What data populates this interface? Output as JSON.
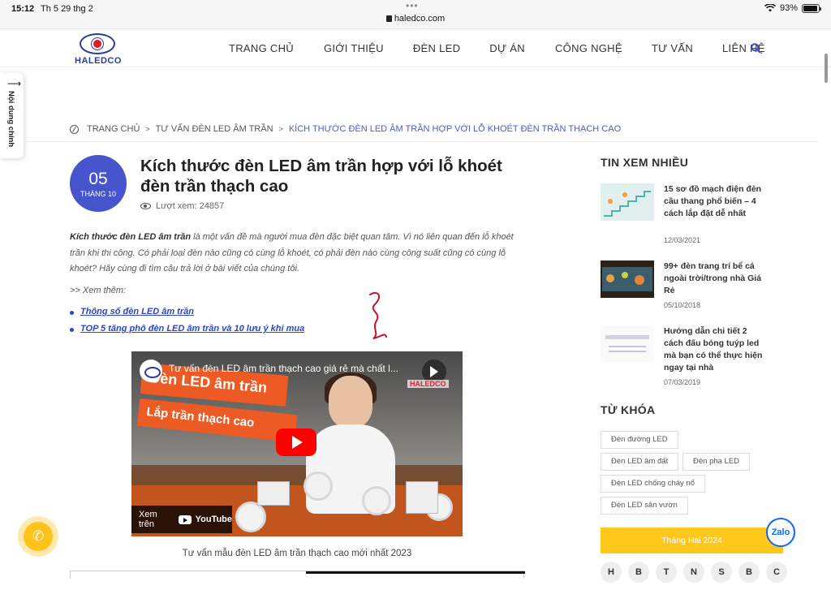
{
  "status_bar": {
    "time": "15:12",
    "date": "Th 5 29 thg 2",
    "url": "haledco.com",
    "battery": "93%",
    "dots": "•••"
  },
  "header": {
    "logo_text": "HALEDCO",
    "nav": [
      "TRANG CHỦ",
      "GIỚI THIỆU",
      "ĐÈN LED",
      "DỰ ÁN",
      "CÔNG NGHỆ",
      "TƯ VẤN",
      "LIÊN HỆ"
    ]
  },
  "side_tab": {
    "label": "Nội dung chính"
  },
  "breadcrumb": {
    "home": "TRANG CHỦ",
    "category": "TƯ VẤN ĐÈN LED ÂM TRẦN",
    "current": "KÍCH THƯỚC ĐÈN LED ÂM TRẦN HỢP VỚI LỖ KHOÉT ĐÈN TRẦN THẠCH CAO"
  },
  "article": {
    "date_day": "05",
    "date_month": "THÁNG 10",
    "title": "Kích thước đèn LED âm trần hợp với lỗ khoét đèn trần thạch cao",
    "views": "Lượt xem: 24857",
    "intro_bold": "Kích thước đèn LED âm trần",
    "intro_rest": " là một vấn đề mà người mua đèn đặc biệt quan tâm. Vì nó liên quan đến lỗ khoét trần khi thi công. Có phải loại đèn nào cũng có cùng lỗ khoét, có phải đèn nào cùng công suất cũng có cùng lỗ khoét? Hãy cùng đi tìm câu trả lời ở bài viết của chúng tôi.",
    "see_also": ">> Xem thêm:",
    "links": [
      "Thông số đèn LED âm trần",
      "TOP 5 tăng phô đèn LED âm trần và 10 lưu ý khi mua"
    ],
    "video": {
      "title": "Tư vấn đèn LED âm trần thạch cao giá rẻ mà chất l...",
      "banner1": "Đèn LED âm trần",
      "banner2": "Lắp trần thạch cao",
      "brand": "HALEDCO",
      "watch_label": "Xem trên",
      "yt_word": "YouTube"
    },
    "caption": "Tư vấn mẫu đèn LED âm trần thạch cao mới nhất 2023"
  },
  "sidebar": {
    "popular_heading": "TIN XEM NHIỀU",
    "posts": [
      {
        "title": "15 sơ đồ mạch điện đèn cầu thang phổ biến – 4 cách lắp đặt dễ nhất",
        "date": "12/03/2021"
      },
      {
        "title": "99+ đèn trang trí bể cá ngoài trời/trong nhà Giá Rẻ",
        "date": "05/10/2018"
      },
      {
        "title": "Hướng dẫn chi tiết 2 cách đấu bóng tuýp led mà bạn có thể thực hiện ngay tại nhà",
        "date": "07/03/2019"
      }
    ],
    "tags_heading": "TỪ KHÓA",
    "tags": [
      "Đèn đường LED",
      "Đèn LED âm đất",
      "Đèn pha LED",
      "Đèn LED chống cháy nổ",
      "Đèn LED sân vườn"
    ],
    "calendar_label": "Tháng Hai 2024",
    "weekdays": [
      "H",
      "B",
      "T",
      "N",
      "S",
      "B",
      "C"
    ]
  },
  "floating": {
    "zalo": "Zalo"
  },
  "colors": {
    "accent": "#4655cc",
    "link": "#2d46c7",
    "yellow": "#ffc21a"
  }
}
